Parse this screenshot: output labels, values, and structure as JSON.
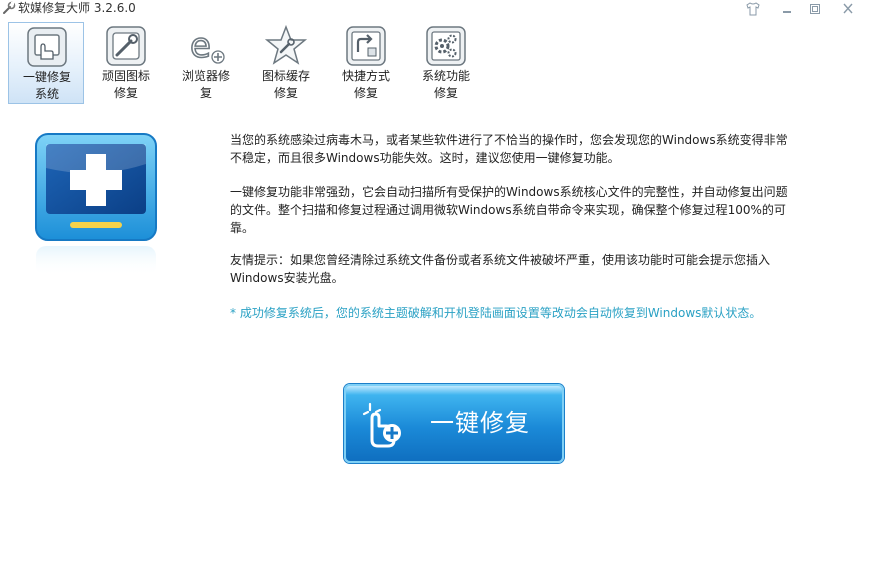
{
  "window": {
    "title": "软媒修复大师 3.2.6.0",
    "controls": [
      "shirt-skin-icon",
      "minimize-icon",
      "maximize-icon",
      "close-icon"
    ]
  },
  "toolbar": {
    "items": [
      {
        "label": "一键修复\n系统",
        "icon": "one-click-repair-icon",
        "active": true
      },
      {
        "label": "顽固图标\n修复",
        "icon": "icon-repair-icon",
        "active": false
      },
      {
        "label": "浏览器修\n复",
        "icon": "browser-repair-icon",
        "active": false
      },
      {
        "label": "图标缓存\n修复",
        "icon": "icon-cache-icon",
        "active": false
      },
      {
        "label": "快捷方式\n修复",
        "icon": "shortcut-repair-icon",
        "active": false
      },
      {
        "label": "系统功能\n修复",
        "icon": "system-function-icon",
        "active": false
      }
    ]
  },
  "content": {
    "hero_icon": "monitor-plus-icon",
    "paragraphs": [
      "当您的系统感染过病毒木马，或者某些软件进行了不恰当的操作时，您会发现您的Windows系统变得非常不稳定，而且很多Windows功能失效。这时，建议您使用一键修复功能。",
      "一键修复功能非常强劲，它会自动扫描所有受保护的Windows系统核心文件的完整性，并自动修复出问题的文件。整个扫描和修复过程通过调用微软Windows系统自带命令来实现，确保整个修复过程100%的可靠。",
      "友情提示：如果您曾经清除过系统文件备份或者系统文件被破坏严重，使用该功能时可能会提示您插入Windows安装光盘。"
    ],
    "note": "* 成功修复系统后，您的系统主题破解和开机登陆画面设置等改动会自动恢复到Windows默认状态。"
  },
  "action": {
    "label": "一键修复",
    "icon": "hand-pointer-plus-icon"
  },
  "colors": {
    "note": "#2aa1c4",
    "button": "#1b8ad8",
    "active_tab": "#cfe3f6"
  }
}
